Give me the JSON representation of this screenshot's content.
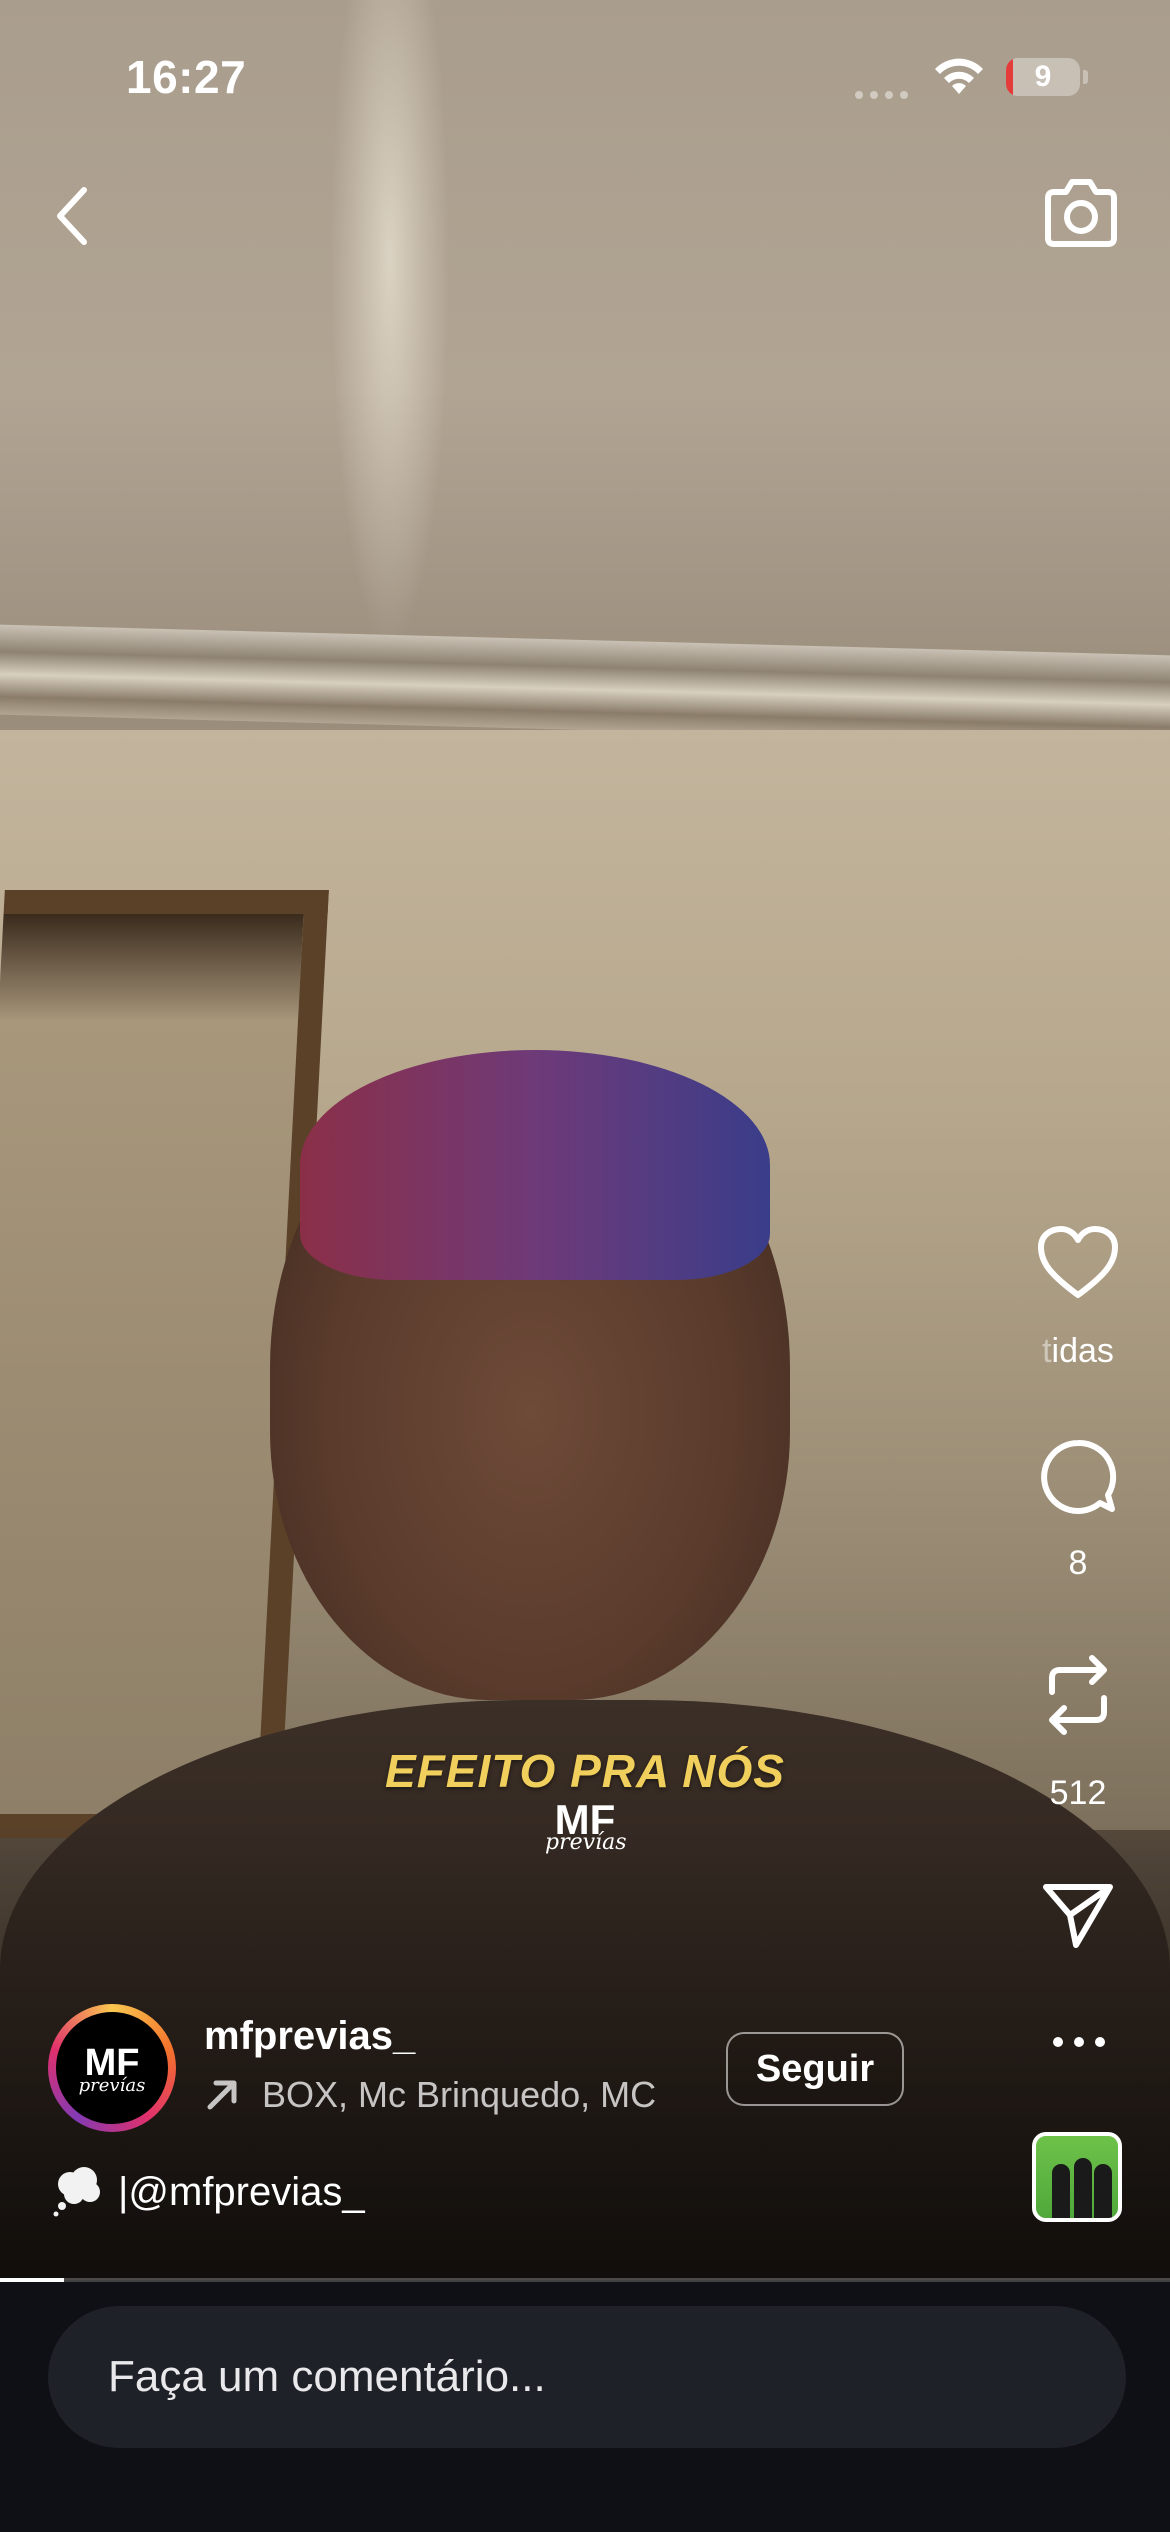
{
  "status_bar": {
    "time": "16:27",
    "battery_level": "9",
    "battery_color": "#e43b3b"
  },
  "nav": {
    "back_icon": "chevron-left-icon",
    "camera_icon": "camera-icon"
  },
  "video_overlay": {
    "caption": "EFEITO PRA NÓS",
    "logo_main": "MF",
    "logo_sub": "prevías"
  },
  "actions": {
    "like_icon": "heart-icon",
    "like_count_fade": "t",
    "like_count": "idas",
    "comment_icon": "comment-icon",
    "comment_count": "8",
    "repost_icon": "repost-icon",
    "repost_count": "512",
    "share_icon": "send-icon",
    "more_icon": "more-horizontal-icon"
  },
  "author": {
    "avatar_main": "MF",
    "avatar_sub": "prevías",
    "username": "mfprevias_",
    "audio_label": "BOX, Mc Brinquedo, MC",
    "follow_label": "Seguir"
  },
  "caption": {
    "text": "|@mfprevias_",
    "icon": "thought-balloon-icon"
  },
  "progress": {
    "fraction": 0.055
  },
  "comment_bar": {
    "placeholder": "Faça um comentário..."
  },
  "colors": {
    "accent_caption": "#f1cf5c",
    "comment_bg": "#0e1015",
    "input_bg": "#1f2128"
  }
}
